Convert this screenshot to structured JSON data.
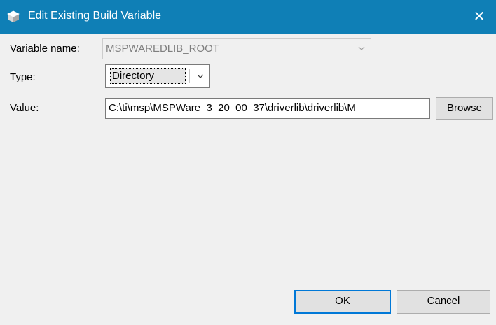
{
  "window": {
    "title": "Edit Existing Build Variable",
    "close_glyph": "✕",
    "icon": "cube-icon"
  },
  "form": {
    "variable_name_label": "Variable name:",
    "variable_name_value": "MSPWAREDLIB_ROOT",
    "type_label": "Type:",
    "type_value": "Directory",
    "value_label": "Value:",
    "value_value": "C:\\ti\\msp\\MSPWare_3_20_00_37\\driverlib\\driverlib\\M"
  },
  "buttons": {
    "browse": "Browse",
    "ok": "OK",
    "cancel": "Cancel"
  },
  "colors": {
    "titlebar": "#0f7fb6",
    "default_button_border": "#0078d7"
  }
}
